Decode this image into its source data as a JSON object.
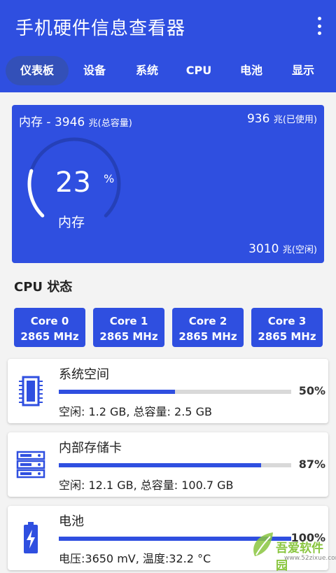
{
  "app": {
    "title": "手机硬件信息查看器"
  },
  "tabs": [
    {
      "label": "仪表板",
      "active": true
    },
    {
      "label": "设备",
      "active": false
    },
    {
      "label": "系统",
      "active": false
    },
    {
      "label": "CPU",
      "active": false
    },
    {
      "label": "电池",
      "active": false
    },
    {
      "label": "显示",
      "active": false
    }
  ],
  "memory": {
    "total_label": "内存 - 3946",
    "total_unit": "兆(总容量)",
    "used_value": "936",
    "used_unit": "兆(已使用)",
    "free_value": "3010",
    "free_unit": "兆(空闲)",
    "percent": "23",
    "percent_sign": "%",
    "gauge_label": "内存",
    "usage_fraction": 0.23
  },
  "cpu": {
    "section_title": "CPU 状态",
    "cores": [
      {
        "name": "Core 0",
        "freq": "2865 MHz"
      },
      {
        "name": "Core 1",
        "freq": "2865 MHz"
      },
      {
        "name": "Core 2",
        "freq": "2865 MHz"
      },
      {
        "name": "Core 3",
        "freq": "2865 MHz"
      }
    ]
  },
  "storage": [
    {
      "icon": "memory-chip-icon",
      "name": "系统空间",
      "percent": "50%",
      "fraction": 0.5,
      "detail": "空闲: 1.2 GB, 总容量: 2.5 GB"
    },
    {
      "icon": "server-icon",
      "name": "内部存储卡",
      "percent": "87%",
      "fraction": 0.87,
      "detail": "空闲: 12.1 GB, 总容量: 100.7 GB"
    },
    {
      "icon": "battery-icon",
      "name": "电池",
      "percent": "100%",
      "fraction": 1.0,
      "detail": "电压:3650 mV, 温度:32.2 °C"
    }
  ],
  "watermark": {
    "text": "吾爱软件园",
    "url": "www.52zixue.com"
  },
  "colors": {
    "primary": "#2f4fe0",
    "active_tab": "#3350b8",
    "track": "#d9d9d9"
  }
}
